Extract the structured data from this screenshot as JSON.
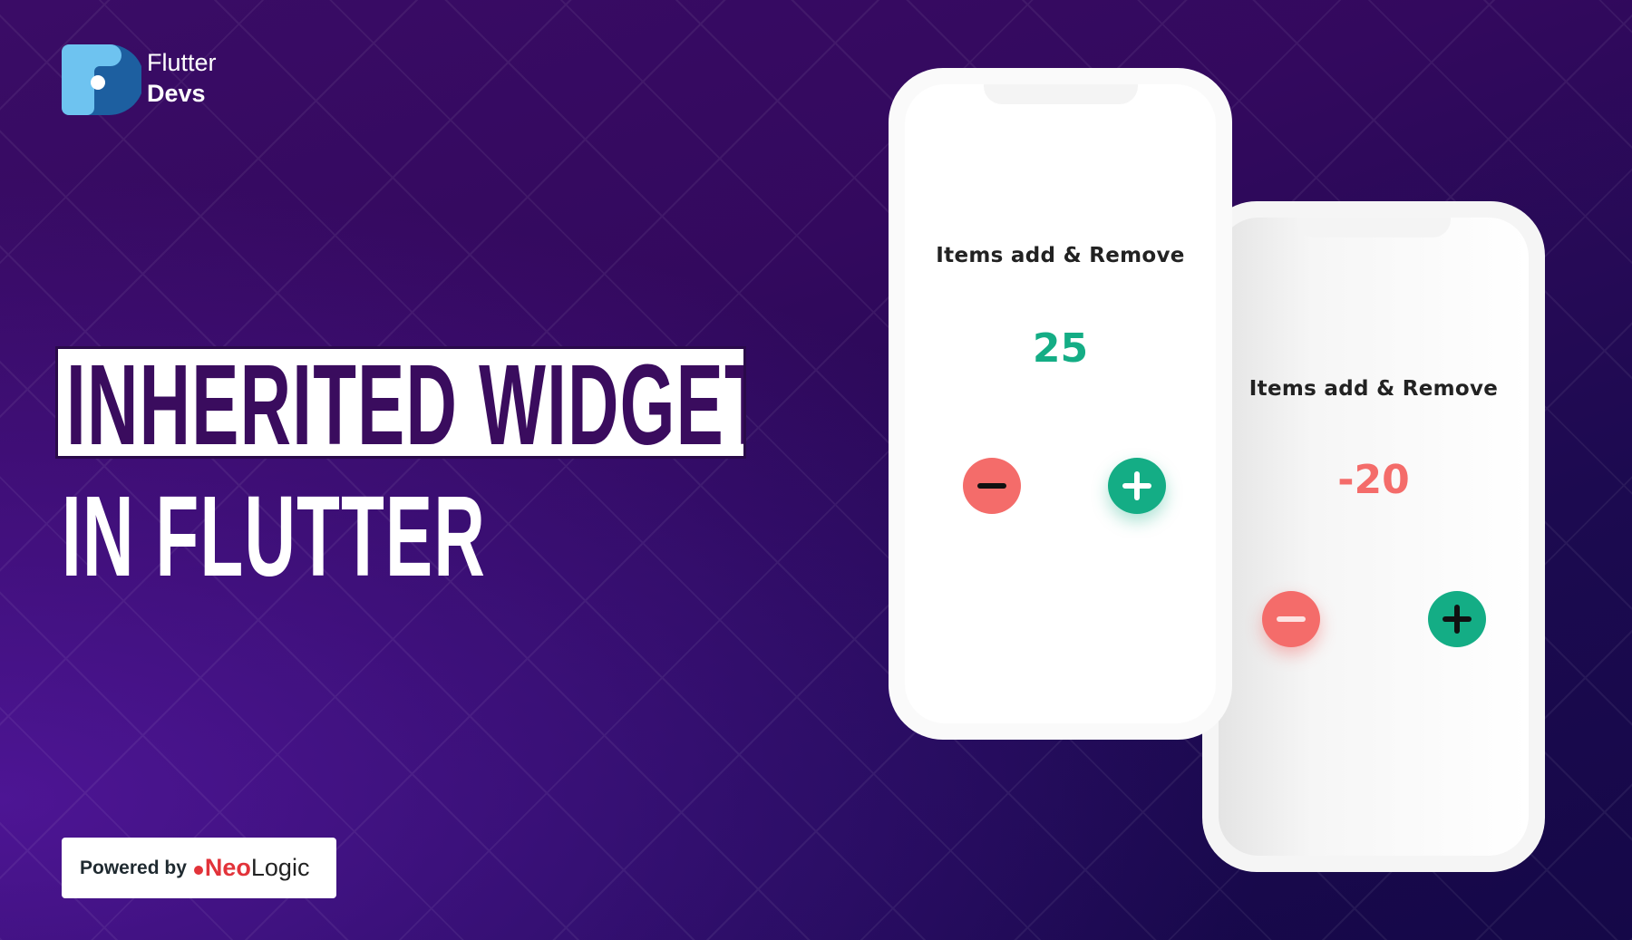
{
  "brand": {
    "line1": "Flutter",
    "line2": "Devs"
  },
  "headline": {
    "line1": "INHERITED WIDGET",
    "line2": "IN FLUTTER"
  },
  "footer": {
    "powered_by": "Powered by",
    "company": "NeoLogic"
  },
  "phones": [
    {
      "title": "Items add & Remove",
      "count": "25",
      "count_color": "#14ad85"
    },
    {
      "title": "Items add & Remove",
      "count": "-20",
      "count_color": "#f46c6a"
    }
  ],
  "colors": {
    "accent_green": "#14ad85",
    "accent_red": "#f46c6a",
    "headline_dark": "#3a0c5e"
  }
}
